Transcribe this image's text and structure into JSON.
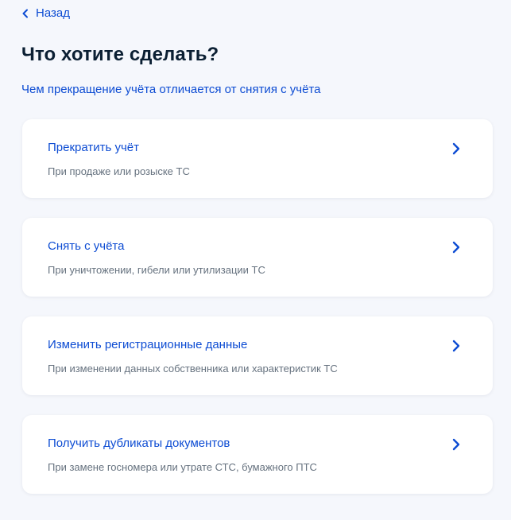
{
  "header": {
    "back_label": "Назад",
    "title": "Что хотите сделать?",
    "info_link": "Чем прекращение учёта отличается от снятия с учёта"
  },
  "options": [
    {
      "title": "Прекратить учёт",
      "description": "При продаже или розыске ТС",
      "icon": "chevron-right-icon"
    },
    {
      "title": "Снять с учёта",
      "description": "При уничтожении, гибели или утилизации ТС",
      "icon": "chevron-right-icon"
    },
    {
      "title": "Изменить регистрационные данные",
      "description": "При изменении данных собственника или характеристик ТС",
      "icon": "chevron-right-icon"
    },
    {
      "title": "Получить дубликаты документов",
      "description": "При замене госномера или утрате СТС, бумажного ПТС",
      "icon": "chevron-right-icon"
    }
  ],
  "colors": {
    "accent": "#0d4cd3",
    "background": "#f5f7fc",
    "card": "#ffffff",
    "title": "#0b1f33",
    "muted": "#66727f"
  }
}
